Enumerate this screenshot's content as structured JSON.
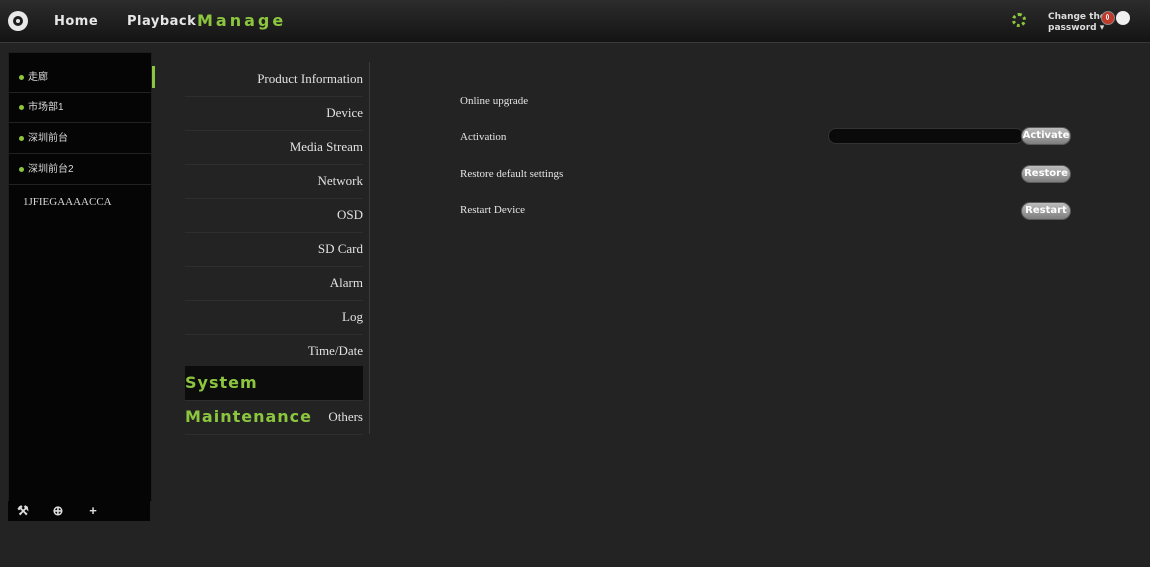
{
  "header": {
    "nav": [
      {
        "label": "Home"
      },
      {
        "label": "Playback"
      },
      {
        "label": "Manage"
      }
    ],
    "change_password_line1": "Change the",
    "change_password_line2": "password ▾"
  },
  "devices": [
    {
      "label": "走廊",
      "online": true,
      "selected": true
    },
    {
      "label": "市场部1",
      "online": true,
      "selected": false
    },
    {
      "label": "深圳前台",
      "online": true,
      "selected": false
    },
    {
      "label": "深圳前台2",
      "online": true,
      "selected": false
    },
    {
      "label": "1JFIEGAAAACCA",
      "online": false,
      "selected": false
    }
  ],
  "device_tools": [
    {
      "icon": "wrench-icon",
      "glyph": "🔧"
    },
    {
      "icon": "zoom-icon",
      "glyph": "⊕"
    },
    {
      "icon": "add-icon",
      "glyph": "+"
    }
  ],
  "menu": [
    {
      "label": "Product Information"
    },
    {
      "label": "Device"
    },
    {
      "label": "Media Stream"
    },
    {
      "label": "Network"
    },
    {
      "label": "OSD"
    },
    {
      "label": "SD Card"
    },
    {
      "label": "Alarm"
    },
    {
      "label": "Log"
    },
    {
      "label": "Time/Date"
    },
    {
      "label": "System Maintenance",
      "active": true
    },
    {
      "label": "Others"
    }
  ],
  "maintenance": {
    "online_upgrade": "Online upgrade",
    "activation": "Activation",
    "activation_value": "",
    "activate_button": "Activate",
    "restore": "Restore default settings",
    "restore_button": "Restore",
    "restart": "Restart Device",
    "restart_button": "Restart"
  },
  "colors": {
    "accent": "#8cc63f",
    "background": "#232323"
  }
}
